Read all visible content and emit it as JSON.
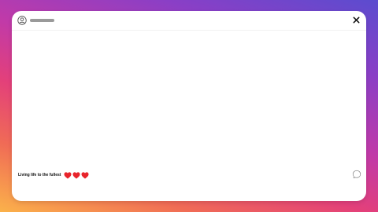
{
  "post": {
    "caption": "Living  life to the fullest",
    "reactions": [
      "heart-icon",
      "heart-icon",
      "heart-icon"
    ]
  },
  "colors": {
    "heart": "#e8242b",
    "username_placeholder": "#9a9a9a",
    "icon_stroke": "#555555",
    "gradient": [
      "#5b4ccf",
      "#c13aa8",
      "#e3407a",
      "#fbb24a"
    ]
  },
  "icons": {
    "avatar": "user-circle-icon",
    "close": "close-icon",
    "comment": "comment-bubble-icon"
  }
}
